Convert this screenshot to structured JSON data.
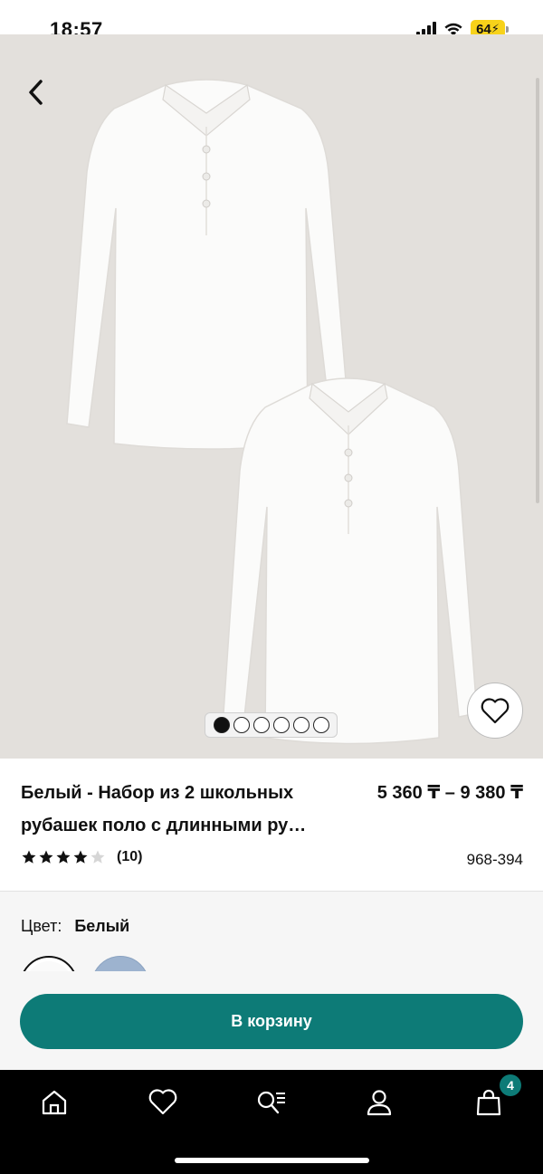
{
  "status_bar": {
    "time": "18:57",
    "battery": "64"
  },
  "product": {
    "title_line1": "Белый - Набор из 2 школьных",
    "title_line2": "рубашек поло с длинными ру…",
    "price": "5 360 ₸ – 9 380 ₸",
    "rating_value": 4,
    "rating_max": 5,
    "rating_count": "(10)",
    "sku": "968-394"
  },
  "gallery": {
    "image_count": 6,
    "active_index": 0
  },
  "color": {
    "label": "Цвет:",
    "value": "Белый",
    "swatches": [
      "#fafafa",
      "#9db3cf"
    ]
  },
  "actions": {
    "add_to_cart_label": "В корзину"
  },
  "nav": {
    "items": [
      "home-icon",
      "heart-icon",
      "search-list-icon",
      "profile-icon",
      "bag-icon"
    ],
    "cart_badge": "4"
  },
  "colors": {
    "accent": "#0d7b77",
    "hero_bg": "#e3e0dc"
  }
}
